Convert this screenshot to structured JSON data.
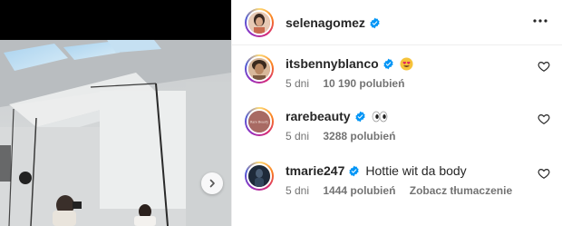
{
  "post": {
    "author": "selenagomez"
  },
  "comments": [
    {
      "username": "itsbennyblanco",
      "text": "",
      "emoji": "heart-eyes",
      "time": "5 dni",
      "likes": "10 190 polubień",
      "translate": ""
    },
    {
      "username": "rarebeauty",
      "text": "",
      "emoji": "eyes",
      "time": "5 dni",
      "likes": "3288 polubień",
      "translate": ""
    },
    {
      "username": "tmarie247",
      "text": "Hottie wit da body",
      "emoji": "",
      "time": "5 dni",
      "likes": "1444 polubień",
      "translate": "Zobacz tłumaczenie"
    }
  ],
  "colors": {
    "verified": "#0095f6",
    "secondary_text": "#737373",
    "primary_text": "#262626"
  }
}
